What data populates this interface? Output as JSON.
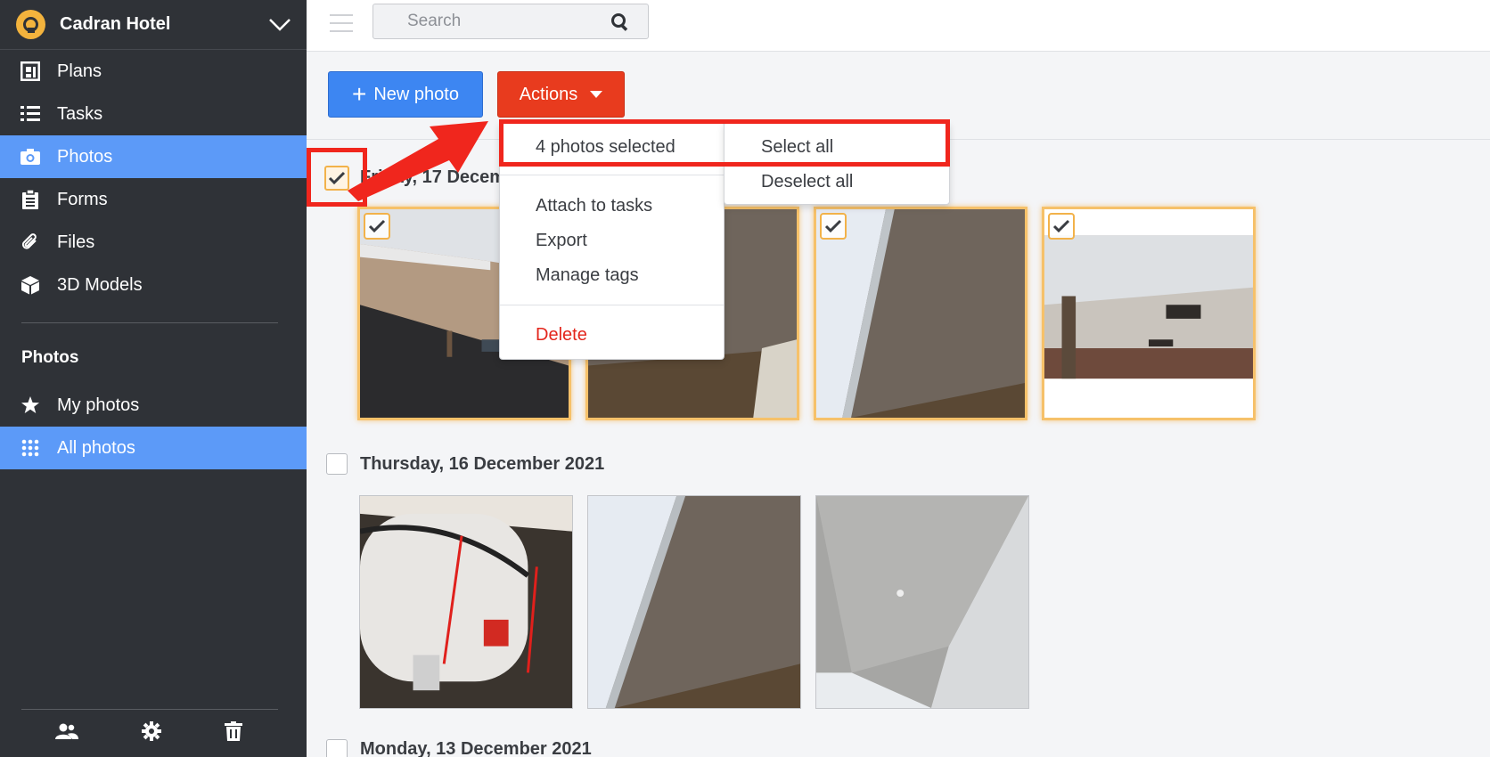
{
  "sidebar": {
    "project_name": "Cadran Hotel",
    "nav": [
      {
        "label": "Plans",
        "icon": "plans-icon"
      },
      {
        "label": "Tasks",
        "icon": "list-icon"
      },
      {
        "label": "Photos",
        "icon": "camera-icon"
      },
      {
        "label": "Forms",
        "icon": "clipboard-icon"
      },
      {
        "label": "Files",
        "icon": "paperclip-icon"
      },
      {
        "label": "3D Models",
        "icon": "cube-icon"
      }
    ],
    "section_title": "Photos",
    "section_items": [
      {
        "label": "My photos",
        "icon": "star-icon"
      },
      {
        "label": "All photos",
        "icon": "grid-icon"
      }
    ],
    "footer_icons": [
      "users-icon",
      "gear-icon",
      "trash-icon"
    ]
  },
  "topbar": {
    "search_placeholder": "Search"
  },
  "toolbar": {
    "new_photo": "New photo",
    "actions": "Actions"
  },
  "actions_menu": {
    "selected_count": "4 photos selected",
    "items": [
      "Attach to tasks",
      "Export",
      "Manage tags"
    ],
    "delete": "Delete",
    "sub_items": [
      "Select all",
      "Deselect all"
    ]
  },
  "groups": [
    {
      "date": "Friday, 17 Decem",
      "selected": true
    },
    {
      "date": "Thursday, 16 December 2021",
      "selected": false
    },
    {
      "date": "Monday, 13 December 2021",
      "selected": false
    }
  ],
  "colors": {
    "sidebar": "#2f3237",
    "active": "#5c9af8",
    "primary": "#3d86f2",
    "danger": "#e83b1e",
    "highlight": "#f0261d"
  }
}
